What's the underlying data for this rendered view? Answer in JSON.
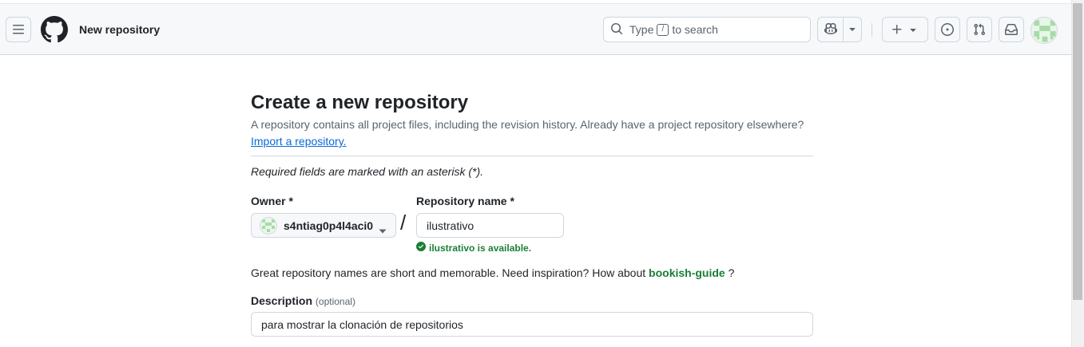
{
  "header": {
    "context_title": "New repository",
    "search": {
      "prefix": "Type",
      "key": "/",
      "suffix": "to search"
    }
  },
  "icons": {
    "menu": "hamburger-icon",
    "logo": "github-logo-icon",
    "search": "search-icon",
    "copilot": "copilot-icon",
    "plus": "plus-icon",
    "caret": "triangle-down-icon",
    "issues": "issue-opened-icon",
    "pull_requests": "git-pull-request-icon",
    "inbox": "inbox-icon",
    "check": "check-circle-fill-icon"
  },
  "form": {
    "title": "Create a new repository",
    "subtitle": "A repository contains all project files, including the revision history. Already have a project repository elsewhere?",
    "import_link": "Import a repository.",
    "required_note": "Required fields are marked with an asterisk (*).",
    "owner_label": "Owner *",
    "owner_value": "s4ntiag0p4l4aci0",
    "separator": "/",
    "repo_label": "Repository name *",
    "repo_value": "ilustrativo",
    "availability": "ilustrativo is available.",
    "inspiration_text": "Great repository names are short and memorable. Need inspiration? How about",
    "suggestion": "bookish-guide",
    "inspiration_end": "?",
    "description_label": "Description",
    "optional_label": "(optional)",
    "description_value": "para mostrar la clonación de repositorios"
  },
  "colors": {
    "header_bg": "#f6f8fa",
    "border": "#d0d7de",
    "link": "#0969da",
    "success": "#1a7f37",
    "text": "#1f2328",
    "muted": "#59636e"
  }
}
